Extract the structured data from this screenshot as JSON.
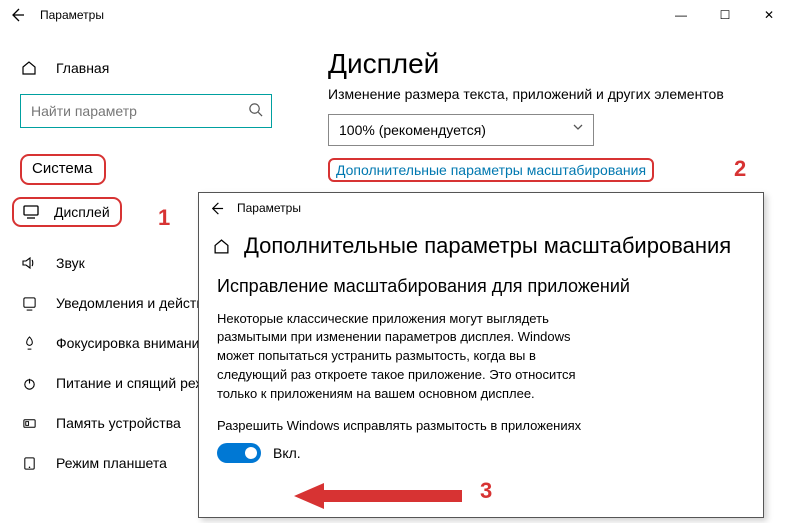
{
  "window": {
    "title": "Параметры",
    "controls": {
      "min": "—",
      "max": "☐",
      "close": "✕"
    }
  },
  "sidebar": {
    "home_label": "Главная",
    "search_placeholder": "Найти параметр",
    "section_label": "Система",
    "items": [
      {
        "icon": "display-icon",
        "label": "Дисплей"
      },
      {
        "icon": "sound-icon",
        "label": "Звук"
      },
      {
        "icon": "notify-icon",
        "label": "Уведомления и действия"
      },
      {
        "icon": "focus-icon",
        "label": "Фокусировка внимания"
      },
      {
        "icon": "power-icon",
        "label": "Питание и спящий режим"
      },
      {
        "icon": "storage-icon",
        "label": "Память устройства"
      },
      {
        "icon": "tablet-icon",
        "label": "Режим планшета"
      }
    ]
  },
  "main": {
    "heading": "Дисплей",
    "subheading": "Изменение размера текста, приложений и других элементов",
    "scale_dropdown": "100% (рекомендуется)",
    "adv_link": "Дополнительные параметры масштабирования"
  },
  "overlay": {
    "title": "Параметры",
    "heading": "Дополнительные параметры масштабирования",
    "section_heading": "Исправление масштабирования для приложений",
    "description": "Некоторые классические приложения могут выглядеть размытыми при изменении параметров дисплея. Windows может попытаться устранить размытость, когда вы в следующий раз откроете такое приложение. Это относится только к приложениям на вашем основном дисплее.",
    "allow_label": "Разрешить Windows исправлять размытость в приложениях",
    "toggle_state": "Вкл."
  },
  "annotations": {
    "n1": "1",
    "n2": "2",
    "n3": "3"
  }
}
